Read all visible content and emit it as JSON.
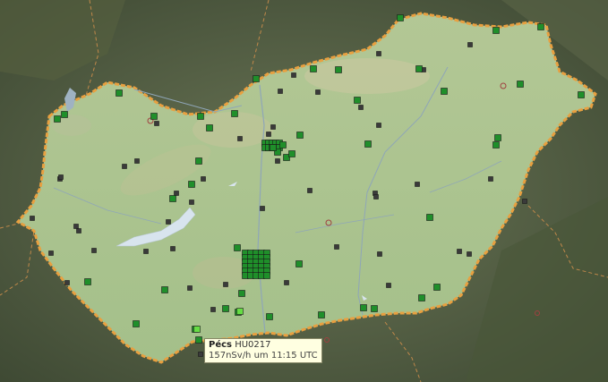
{
  "tooltip": {
    "city": "Pécs",
    "station_id": "HU0217",
    "reading": "157nSv/h um 11:15 UTC"
  },
  "colors": {
    "country_fill": "#a9c48e",
    "border": "#e8a040",
    "marker_green": "#1f8f2a",
    "marker_inactive": "#3a3a3a",
    "marker_highlight": "#66dd44",
    "water": "#d8e4ee"
  }
}
